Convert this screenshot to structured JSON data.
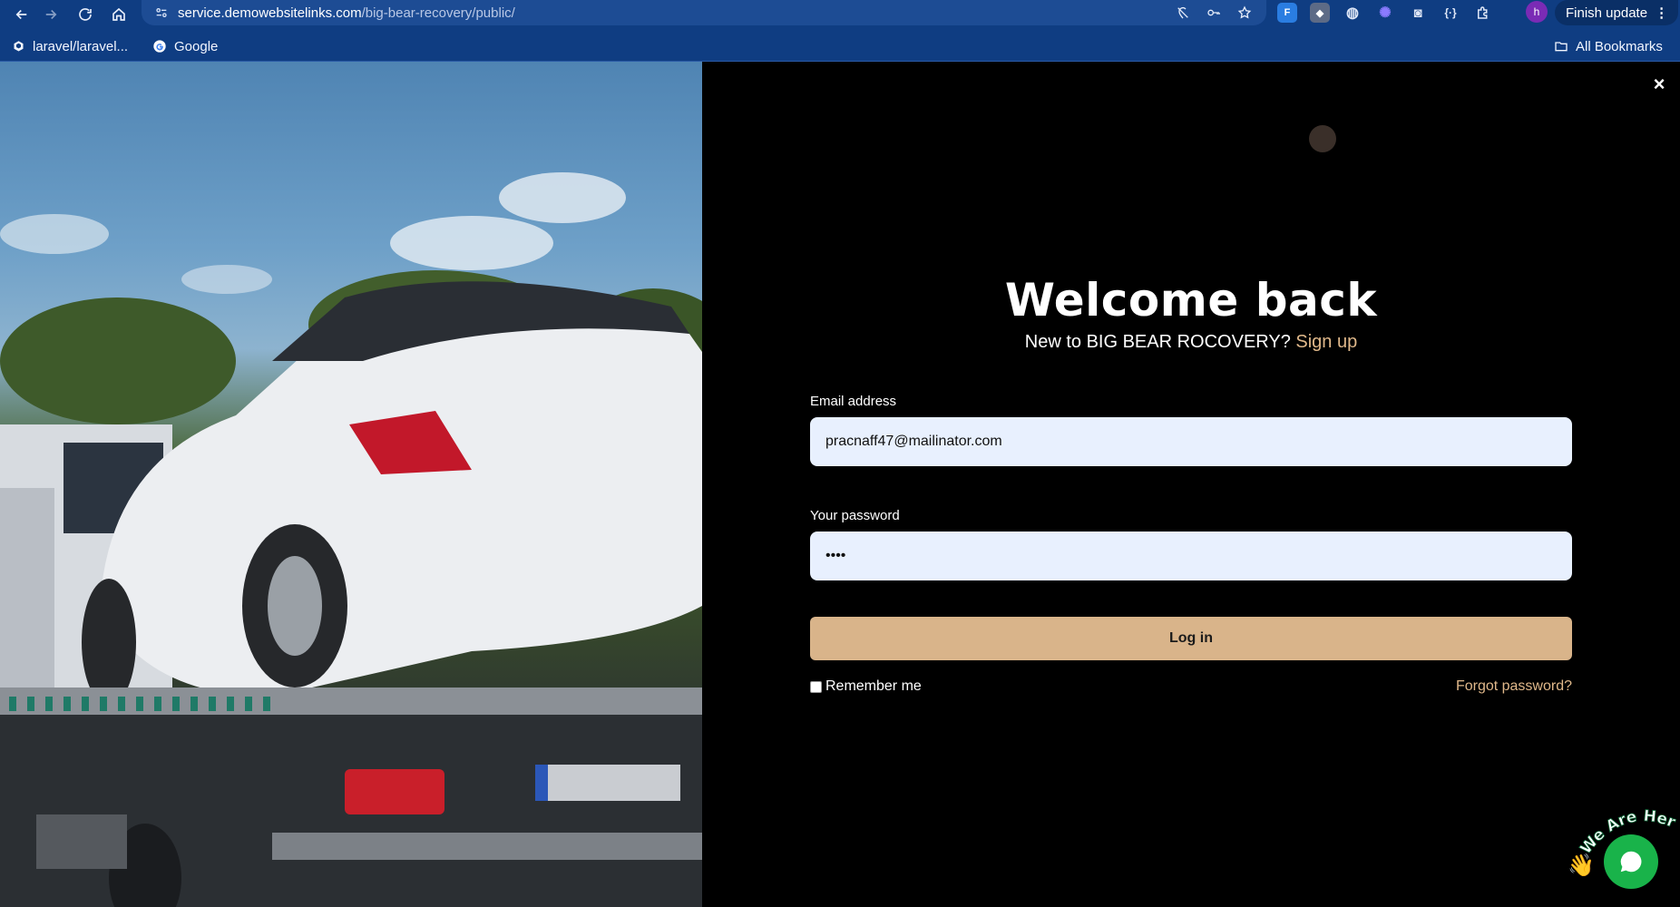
{
  "browser": {
    "url_host": "service.demowebsitelinks.com",
    "url_path": "/big-bear-recovery/public/",
    "profile_initial": "h",
    "finish_update_label": "Finish update",
    "menu_label": "⋮"
  },
  "bookmarks": {
    "items": [
      {
        "label": "laravel/laravel..."
      },
      {
        "label": "Google"
      }
    ],
    "all_bookmarks_label": "All Bookmarks"
  },
  "login": {
    "close_label": "×",
    "title": "Welcome back",
    "subtitle_prefix": "New to BIG BEAR ROCOVERY?",
    "signup_label": "Sign up",
    "email_label": "Email address",
    "email_value": "pracnaff47@mailinator.com",
    "password_label": "Your password",
    "password_value": "••••",
    "login_button": "Log in",
    "remember_label": "Remember me",
    "forgot_label": "Forgot password?"
  },
  "chat": {
    "tag_text": "We Are Here!",
    "wave_emoji": "👋"
  },
  "colors": {
    "accent": "#d9b48a",
    "link": "#e0b88a",
    "chat": "#19b34a",
    "browser_bar": "#0f3d82"
  }
}
